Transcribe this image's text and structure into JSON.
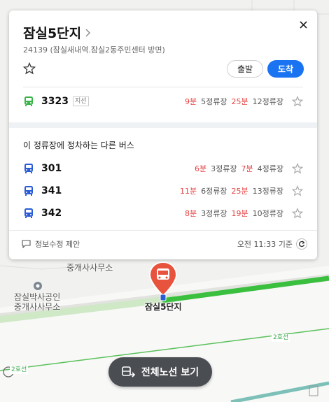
{
  "panel": {
    "title": "잠실5단지",
    "subtitle": "24139 (잠실새내역.잠실2동주민센터 방면)",
    "depart_label": "출발",
    "arrive_label": "도착",
    "section_title": "이 정류장에 정차하는 다른 버스",
    "footer_edit": "정보수정 제안",
    "footer_time": "오전 11:33 기준"
  },
  "main_bus": {
    "number": "3323",
    "tag": "지선",
    "color": "#3bb54a",
    "first_time": "9분",
    "first_stops": "5정류장",
    "second_time": "25분",
    "second_stops": "12정류장"
  },
  "other_buses": [
    {
      "number": "301",
      "color": "#2a5cd6",
      "first_time": "6분",
      "first_stops": "3정류장",
      "second_time": "7분",
      "second_stops": "4정류장"
    },
    {
      "number": "341",
      "color": "#2a5cd6",
      "first_time": "11분",
      "first_stops": "6정류장",
      "second_time": "25분",
      "second_stops": "13정류장"
    },
    {
      "number": "342",
      "color": "#2a5cd6",
      "first_time": "8분",
      "first_stops": "3정류장",
      "second_time": "19분",
      "second_stops": "10정류장"
    }
  ],
  "map": {
    "poi_top": "중개사사무소",
    "poi_left_line1": "잠실박사공인",
    "poi_left_line2": "중개사사무소",
    "stop_label": "잠실5단지",
    "line_tag_1": "2호선",
    "line_tag_2": "2호선",
    "route_button": "전체노선 보기",
    "accent_red": "#e8533d",
    "line_green": "#3bbf3f"
  }
}
